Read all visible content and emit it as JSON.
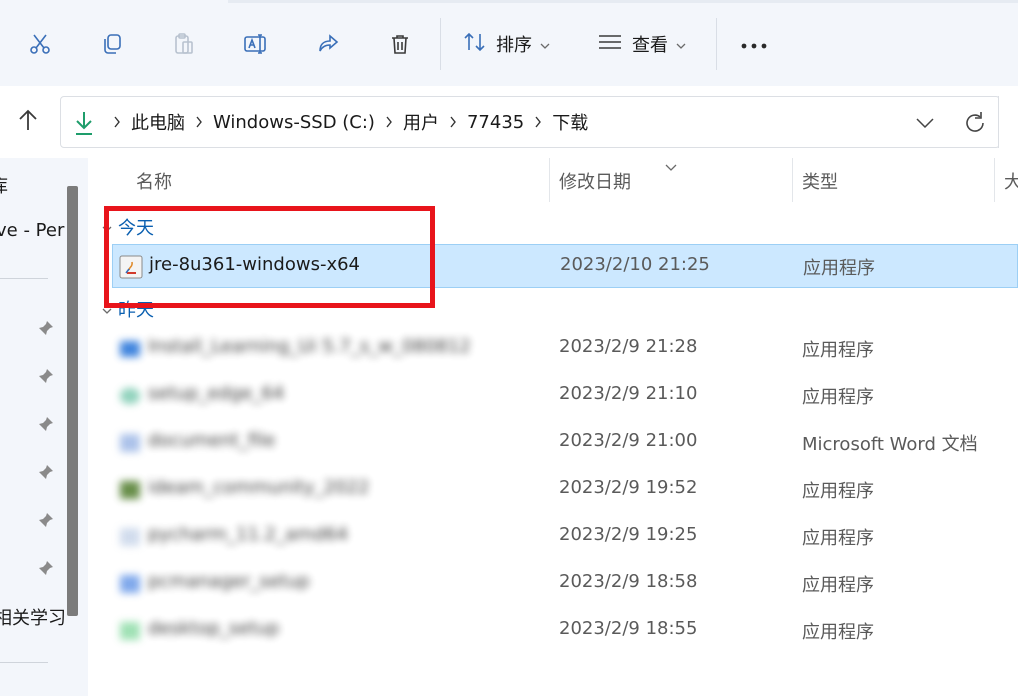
{
  "toolbar": {
    "sort_label": "排序",
    "view_label": "查看",
    "icons": [
      "cut-icon",
      "copy-icon",
      "paste-icon",
      "rename-icon",
      "share-icon",
      "delete-icon",
      "sort-icon",
      "view-icon",
      "more-icon"
    ]
  },
  "address": {
    "crumbs": [
      "此电脑",
      "Windows-SSD (C:)",
      "用户",
      "77435",
      "下载"
    ]
  },
  "nav": {
    "top_partial": "库",
    "onedrive_partial": "ve - Per",
    "bottom_partial": "相关学习"
  },
  "columns": {
    "name": "名称",
    "date": "修改日期",
    "type": "类型",
    "size": "大"
  },
  "groups": {
    "today": "今天",
    "yesterday": "昨天"
  },
  "files": [
    {
      "name": "jre-8u361-windows-x64",
      "date": "2023/2/10 21:25",
      "type": "应用程序"
    },
    {
      "name": "Install_Learning_Ui 5.7_s_w_080812",
      "date": "2023/2/9 21:28",
      "type": "应用程序"
    },
    {
      "name": "setup_edge_64",
      "date": "2023/2/9 21:10",
      "type": "应用程序"
    },
    {
      "name": "document_file",
      "date": "2023/2/9 21:00",
      "type": "Microsoft Word 文档"
    },
    {
      "name": "ideam_community_2022",
      "date": "2023/2/9 19:52",
      "type": "应用程序"
    },
    {
      "name": "pycharm_11.2_amd64",
      "date": "2023/2/9 19:25",
      "type": "应用程序"
    },
    {
      "name": "pcmanager_setup",
      "date": "2023/2/9 18:58",
      "type": "应用程序"
    },
    {
      "name": "desktop_setup",
      "date": "2023/2/9 18:55",
      "type": "应用程序"
    }
  ],
  "colors": {
    "selection": "#cce8ff",
    "highlight_box": "#e8141b",
    "group_text": "#0a5fb0",
    "download_arrow": "#1e9d6b"
  }
}
